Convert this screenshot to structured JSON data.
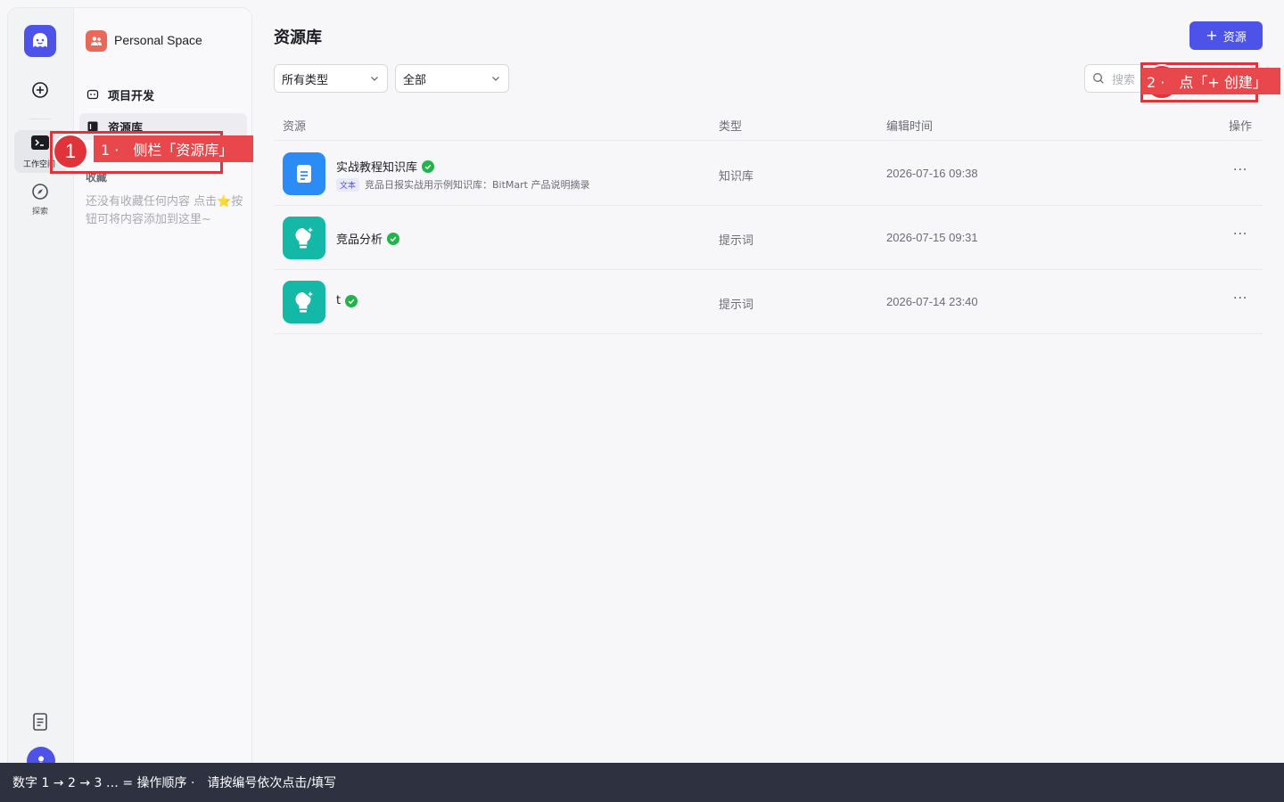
{
  "rail": {
    "workspace_label": "工作空间",
    "explore_label": "探索"
  },
  "sidebar": {
    "space_name": "Personal Space",
    "nav_project": "项目开发",
    "nav_resources": "资源库",
    "favorites_title": "收藏",
    "favorites_empty": "还没有收藏任何内容 点击⭐按钮可将内容添加到这里~"
  },
  "main": {
    "title": "资源库",
    "add_button": "资源",
    "filter_type": "所有类型",
    "filter_owner": "全部",
    "search_placeholder": "搜索",
    "columns": {
      "resource": "资源",
      "type": "类型",
      "edited": "编辑时间",
      "actions": "操作"
    },
    "rows": [
      {
        "name": "实战教程知识库",
        "tag": "文本",
        "desc": "竞品日报实战用示例知识库：BitMart 产品说明摘录",
        "type": "知识库",
        "time": "2026-07-16 09:38",
        "icon": "document-icon",
        "color": "#2b8cf6"
      },
      {
        "name": "竞品分析",
        "type": "提示词",
        "time": "2026-07-15 09:31",
        "icon": "lightbulb-icon",
        "color": "#14b8a6"
      },
      {
        "name": "t",
        "type": "提示词",
        "time": "2026-07-14 23:40",
        "icon": "lightbulb-icon",
        "color": "#14b8a6"
      }
    ],
    "more": "···"
  },
  "annotations": {
    "step1_number": "1",
    "step1_label": "1 ·　侧栏「资源库」",
    "step2_label": "2 ·　点「+ 创建」"
  },
  "bottom_bar": "数字 1 → 2 → 3 … = 操作顺序 ·　请按编号依次点击/填写",
  "colors": {
    "accent": "#4d53e8",
    "annotation": "#e0343a",
    "verified": "#21b44b"
  }
}
